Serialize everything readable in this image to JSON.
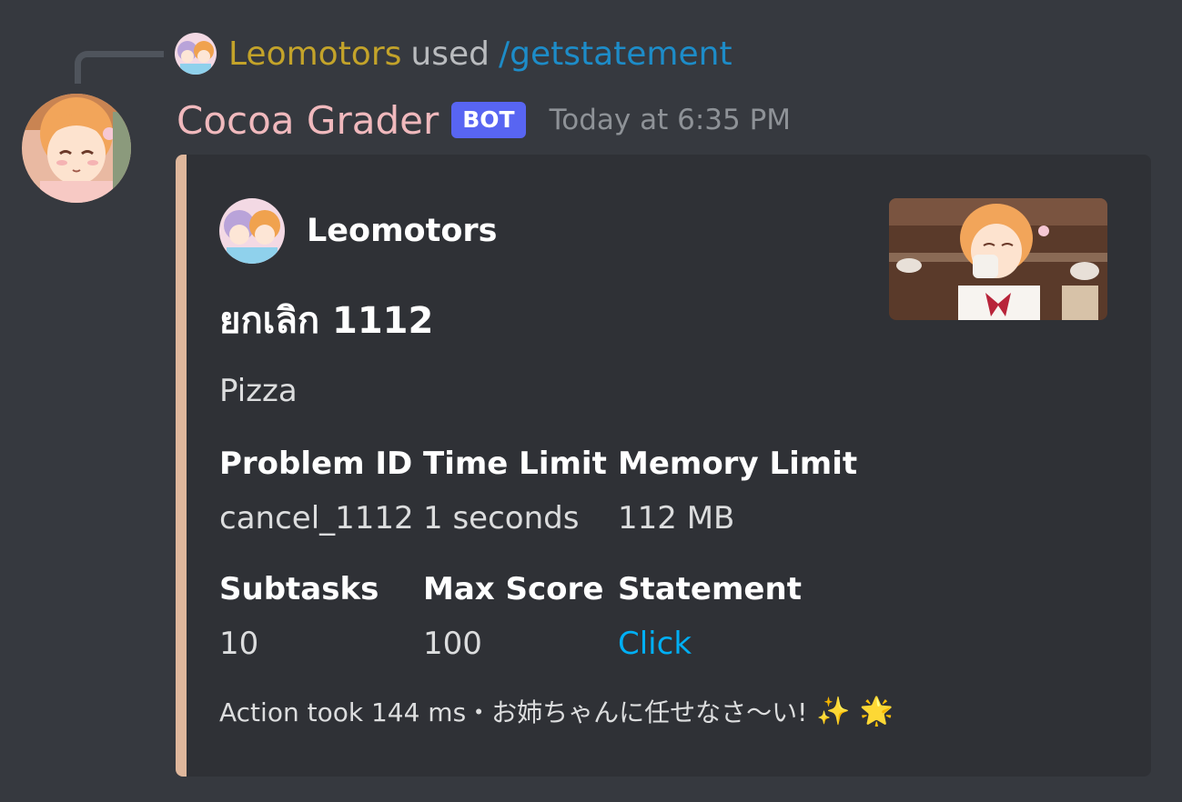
{
  "reply": {
    "username": "Leomotors",
    "used_text": "used",
    "command": "/getstatement"
  },
  "message": {
    "author": "Cocoa Grader",
    "bot_tag": "BOT",
    "timestamp": "Today at 6:35 PM"
  },
  "embed": {
    "accent_color": "#dfb79c",
    "author_name": "Leomotors",
    "title": "ยกเลิก 1112",
    "description": "Pizza",
    "fields": [
      {
        "name": "Problem ID",
        "value": "cancel_1112"
      },
      {
        "name": "Time Limit",
        "value": "1 seconds"
      },
      {
        "name": "Memory Limit",
        "value": "112 MB"
      },
      {
        "name": "Subtasks",
        "value": "10"
      },
      {
        "name": "Max Score",
        "value": "100"
      },
      {
        "name": "Statement",
        "value": "Click"
      }
    ],
    "footer": {
      "text": "Action took 144 ms・お姉ちゃんに任せなさ〜い!",
      "emoji_1": "✨",
      "emoji_2": "🌟"
    }
  },
  "colors": {
    "background": "#36393f",
    "embed_bg": "#2f3136",
    "reply_user": "#c3a32a",
    "command": "#1d8cc8",
    "author": "#f0b9bd",
    "bot_tag": "#5865f2",
    "link": "#00aff4"
  },
  "icons": {
    "reply_avatar": "anime-avatar-icon",
    "bot_avatar": "anime-girl-avatar-icon",
    "embed_thumbnail": "anime-girl-drinking-tea-thumbnail"
  }
}
